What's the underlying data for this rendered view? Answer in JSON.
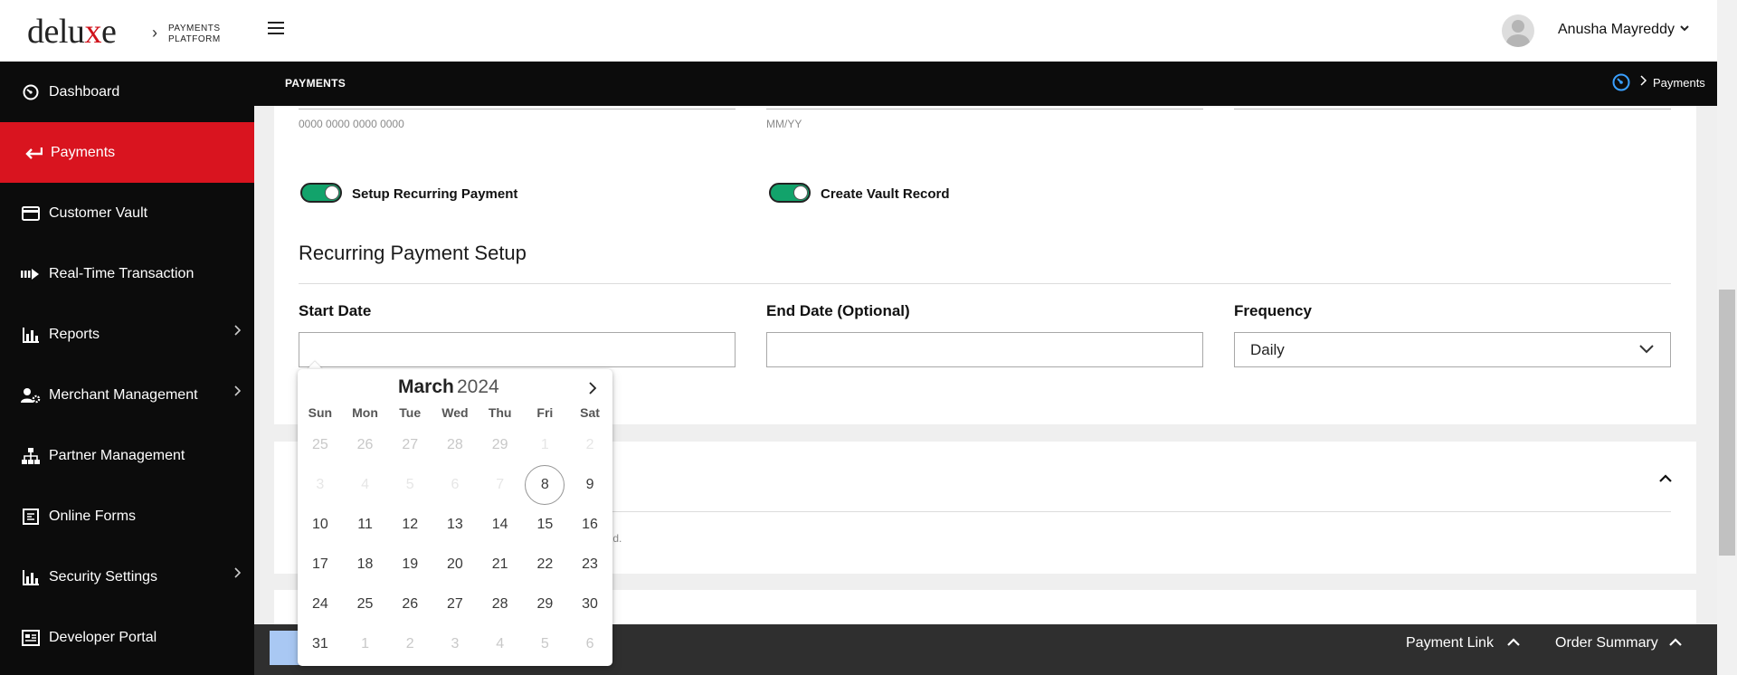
{
  "header": {
    "logo_text_1": "delu",
    "logo_text_x": "x",
    "logo_text_2": "e",
    "logo_subtitle_1": "PAYMENTS",
    "logo_subtitle_2": "PLATFORM",
    "user_name": "Anusha Mayreddy"
  },
  "sidebar": {
    "items": [
      {
        "label": "Dashboard",
        "icon": "dashboard-icon"
      },
      {
        "label": "Payments",
        "icon": "payments-arrow-icon",
        "active": true
      },
      {
        "label": "Customer Vault",
        "icon": "card-icon"
      },
      {
        "label": "Real-Time Transaction",
        "icon": "realtime-icon"
      },
      {
        "label": "Reports",
        "icon": "chart-icon",
        "has_children": true
      },
      {
        "label": "Merchant Management",
        "icon": "user-gear-icon",
        "has_children": true
      },
      {
        "label": "Partner Management",
        "icon": "org-chart-icon"
      },
      {
        "label": "Online Forms",
        "icon": "form-icon"
      },
      {
        "label": "Security Settings",
        "icon": "chart-icon",
        "has_children": true
      },
      {
        "label": "Developer Portal",
        "icon": "portal-icon"
      }
    ]
  },
  "section_bar": {
    "title": "PAYMENTS",
    "breadcrumb": "Payments"
  },
  "form": {
    "card_number_hint": "0000 0000 0000 0000",
    "expiry_hint": "MM/YY",
    "recurring_toggle_label": "Setup Recurring Payment",
    "vault_toggle_label": "Create Vault Record",
    "setup_title": "Recurring Payment Setup",
    "start_date_label": "Start Date",
    "end_date_label": "End Date (Optional)",
    "frequency_label": "Frequency",
    "frequency_value": "Daily",
    "start_date_value": "",
    "end_date_value": "",
    "card2_hint_tail": "eld."
  },
  "calendar": {
    "month": "March",
    "year": "2024",
    "weekdays": [
      "Sun",
      "Mon",
      "Tue",
      "Wed",
      "Thu",
      "Fri",
      "Sat"
    ],
    "weeks": [
      [
        {
          "d": "25",
          "s": "muted"
        },
        {
          "d": "26",
          "s": "muted"
        },
        {
          "d": "27",
          "s": "muted"
        },
        {
          "d": "28",
          "s": "muted"
        },
        {
          "d": "29",
          "s": "muted"
        },
        {
          "d": "1",
          "s": "off"
        },
        {
          "d": "2",
          "s": "off"
        }
      ],
      [
        {
          "d": "3",
          "s": "off"
        },
        {
          "d": "4",
          "s": "off"
        },
        {
          "d": "5",
          "s": "off"
        },
        {
          "d": "6",
          "s": "off"
        },
        {
          "d": "7",
          "s": "off"
        },
        {
          "d": "8",
          "s": "today"
        },
        {
          "d": "9",
          "s": ""
        }
      ],
      [
        {
          "d": "10",
          "s": ""
        },
        {
          "d": "11",
          "s": ""
        },
        {
          "d": "12",
          "s": ""
        },
        {
          "d": "13",
          "s": ""
        },
        {
          "d": "14",
          "s": ""
        },
        {
          "d": "15",
          "s": ""
        },
        {
          "d": "16",
          "s": ""
        }
      ],
      [
        {
          "d": "17",
          "s": ""
        },
        {
          "d": "18",
          "s": ""
        },
        {
          "d": "19",
          "s": ""
        },
        {
          "d": "20",
          "s": ""
        },
        {
          "d": "21",
          "s": ""
        },
        {
          "d": "22",
          "s": ""
        },
        {
          "d": "23",
          "s": ""
        }
      ],
      [
        {
          "d": "24",
          "s": ""
        },
        {
          "d": "25",
          "s": ""
        },
        {
          "d": "26",
          "s": ""
        },
        {
          "d": "27",
          "s": ""
        },
        {
          "d": "28",
          "s": ""
        },
        {
          "d": "29",
          "s": ""
        },
        {
          "d": "30",
          "s": ""
        }
      ],
      [
        {
          "d": "31",
          "s": ""
        },
        {
          "d": "1",
          "s": "muted"
        },
        {
          "d": "2",
          "s": "muted"
        },
        {
          "d": "3",
          "s": "muted"
        },
        {
          "d": "4",
          "s": "muted"
        },
        {
          "d": "5",
          "s": "muted"
        },
        {
          "d": "6",
          "s": "muted"
        }
      ]
    ]
  },
  "bottom_bar": {
    "payment_link": "Payment Link",
    "order_summary": "Order Summary"
  },
  "colors": {
    "brand_red": "#d9141f",
    "toggle_on": "#12a36b",
    "sidebar_bg": "#0c0c0c"
  }
}
